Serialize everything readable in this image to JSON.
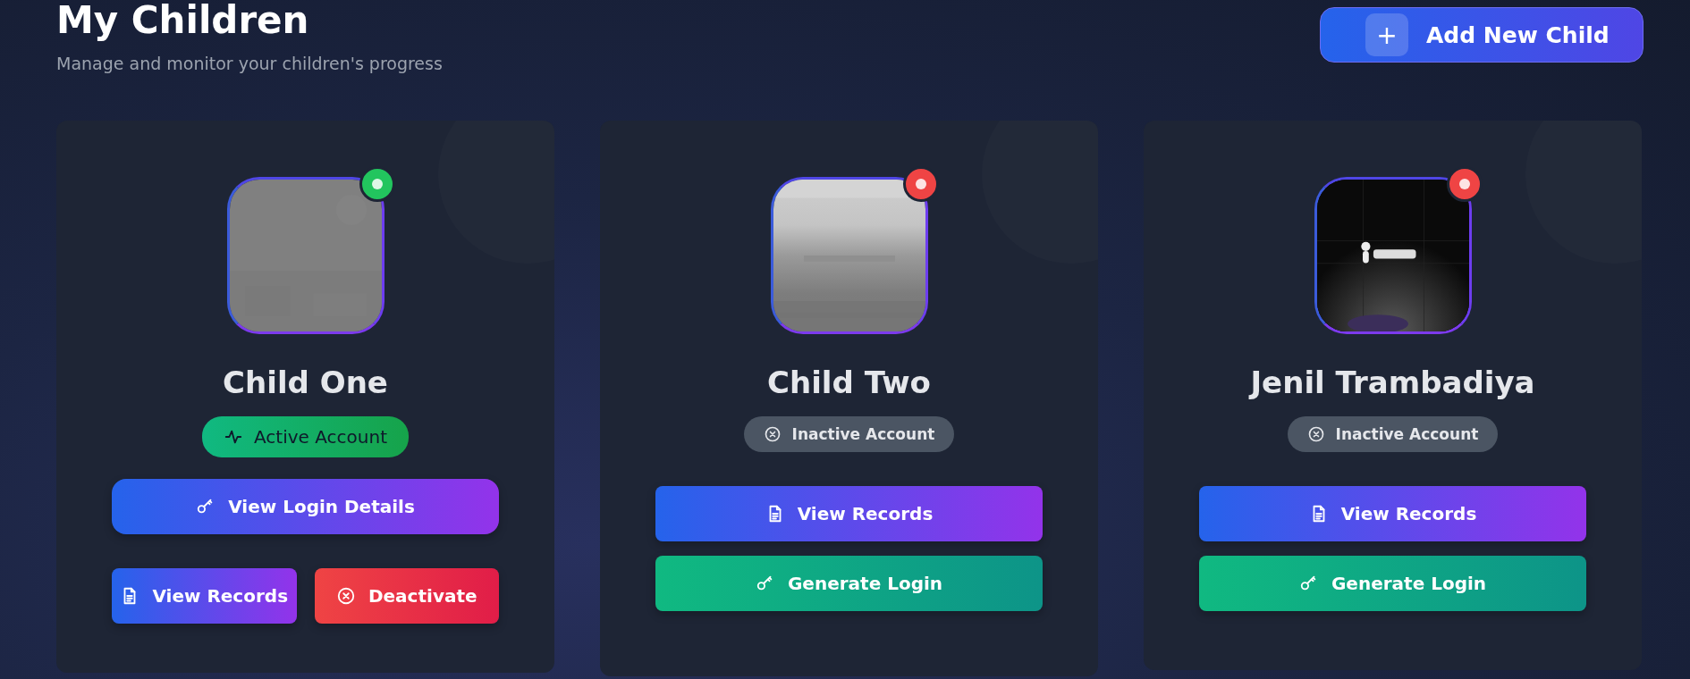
{
  "header": {
    "title": "My Children",
    "subtitle": "Manage and monitor your children's progress",
    "add_button": {
      "icon": "+",
      "label": "Add New Child"
    }
  },
  "children": [
    {
      "name": "Child One",
      "avatar": {
        "kind": "picture"
      },
      "active": true,
      "badge": "Active Account",
      "action_rows": [
        [
          {
            "kind": "login-details",
            "label": "View Login Details"
          }
        ],
        [
          {
            "kind": "records",
            "label": "View Records"
          },
          {
            "kind": "deactivate",
            "label": "Deactivate"
          }
        ]
      ]
    },
    {
      "name": "Child Two",
      "avatar": {
        "kind": "picture"
      },
      "active": false,
      "badge": "Inactive Account",
      "action_rows": [
        [
          {
            "kind": "records",
            "label": "View Records"
          }
        ],
        [
          {
            "kind": "generate-login",
            "label": "Generate Login"
          }
        ]
      ]
    },
    {
      "name": "Jenil Trambadiya",
      "avatar": {
        "kind": "picture"
      },
      "active": false,
      "badge": "Inactive Account",
      "action_rows": [
        [
          {
            "kind": "records",
            "label": "View Records"
          }
        ],
        [
          {
            "kind": "generate-login",
            "label": "Generate Login"
          }
        ]
      ]
    }
  ]
}
